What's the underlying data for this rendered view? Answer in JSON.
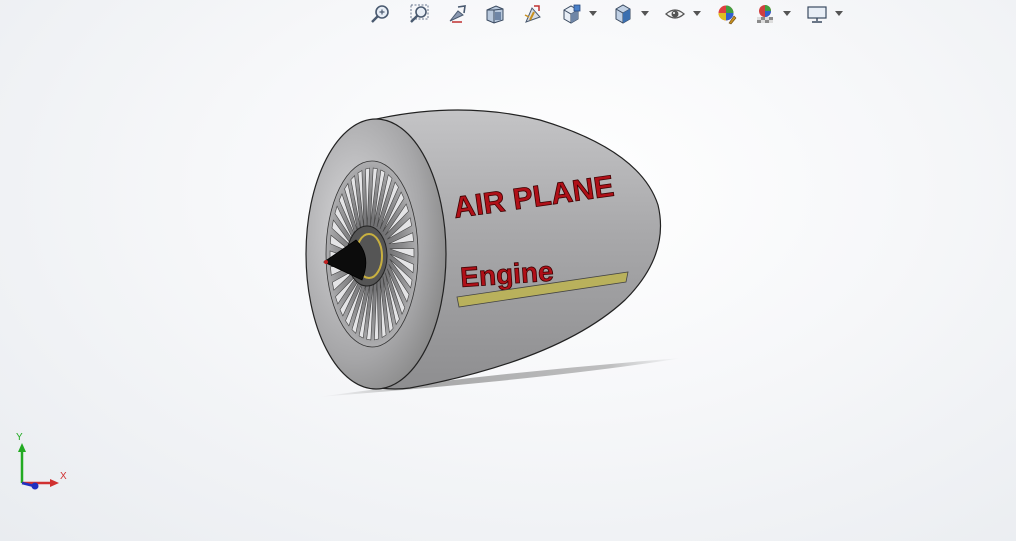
{
  "toolbar": {
    "items": [
      {
        "icon": "zoom-to-fit-icon",
        "has_dropdown": false
      },
      {
        "icon": "zoom-to-area-icon",
        "has_dropdown": false
      },
      {
        "icon": "previous-view-icon",
        "has_dropdown": false
      },
      {
        "icon": "section-view-icon",
        "has_dropdown": false
      },
      {
        "icon": "dynamic-annotation-views-icon",
        "has_dropdown": false
      },
      {
        "icon": "view-orientation-icon",
        "has_dropdown": true
      },
      {
        "icon": "display-style-icon",
        "has_dropdown": true
      },
      {
        "icon": "hide-show-items-icon",
        "has_dropdown": true
      },
      {
        "icon": "edit-appearance-icon",
        "has_dropdown": false
      },
      {
        "icon": "apply-scene-icon",
        "has_dropdown": true
      },
      {
        "icon": "view-settings-icon",
        "has_dropdown": true
      }
    ]
  },
  "model": {
    "text_line1": "AIR PLANE",
    "text_line2": "Engine",
    "text_color": "#b01018",
    "stripe_color": "#b9b15c",
    "body_color": "#a9a9ab"
  },
  "triad": {
    "y_label": "Y",
    "x_label": "X",
    "y_color": "#22aa22",
    "x_color": "#d03030",
    "z_color": "#2030c0"
  }
}
